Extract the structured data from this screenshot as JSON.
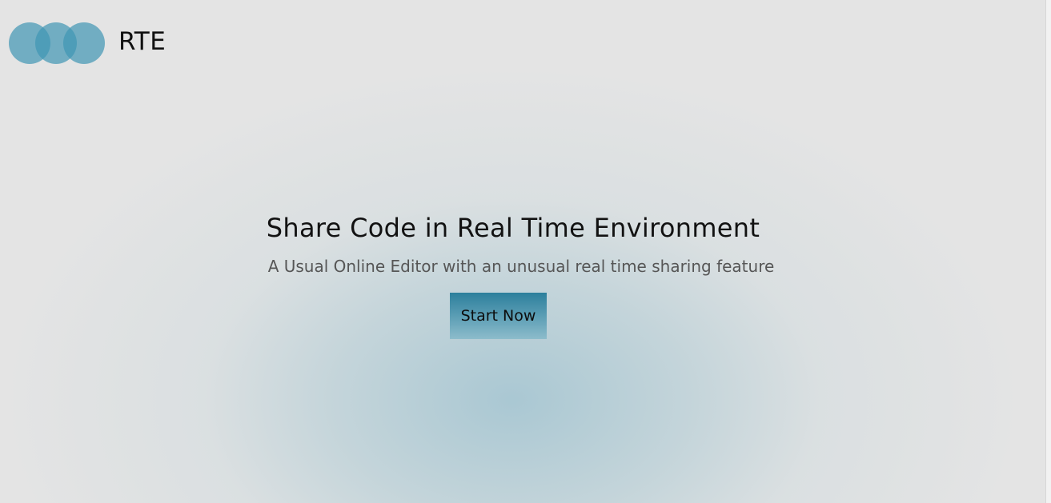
{
  "header": {
    "brand": "RTE",
    "logo_icon": "three-overlapping-circles-logo"
  },
  "hero": {
    "title": "Share Code in Real Time Environment",
    "subtitle": "A Usual Online Editor with an unusual real time sharing feature",
    "cta_label": "Start Now"
  },
  "colors": {
    "background": "#e4e4e4",
    "accent": "#2c7f9c",
    "logo_circle": "#4096b4",
    "title_text": "#121212",
    "subtitle_text": "#565656"
  }
}
